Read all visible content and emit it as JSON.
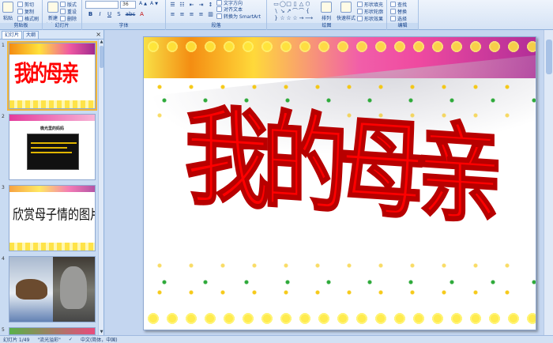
{
  "ribbon": {
    "clipboard": {
      "paste_label": "粘贴",
      "cut_label": "剪切",
      "copy_label": "复制",
      "format_painter_label": "格式刷",
      "group_label": "剪贴板"
    },
    "slides": {
      "new_slide_label": "新建\n幻灯片",
      "layout_label": "版式",
      "reset_label": "重设",
      "delete_label": "删除",
      "group_label": "幻灯片"
    },
    "font": {
      "font_name": "",
      "font_size": "36",
      "format_buttons": [
        "B",
        "I",
        "U",
        "S",
        "abc",
        "A"
      ],
      "group_label": "字体"
    },
    "paragraph": {
      "text_direction_label": "文字方向",
      "align_text_label": "对齐文本",
      "smartart_label": "转换为 SmartArt",
      "group_label": "段落"
    },
    "drawing": {
      "shapes": [
        "▭",
        "◯",
        "□",
        "▯",
        "△",
        "⬡",
        "\\",
        "↘",
        "↗",
        "⌒",
        "⌒",
        "{",
        "}",
        "☆",
        "☆",
        "☆",
        "→",
        "⟶"
      ],
      "arrange_label": "排列",
      "quick_styles_label": "快速样式",
      "fill_label": "形状填充",
      "outline_label": "形状轮廓",
      "effects_label": "形状效果",
      "group_label": "绘图"
    },
    "editing": {
      "find_label": "查找",
      "replace_label": "替换",
      "select_label": "选择",
      "group_label": "编辑"
    }
  },
  "panel": {
    "tabs": [
      "幻灯片",
      "大纲"
    ],
    "close_glyph": "×",
    "slides": [
      {
        "number": "1",
        "title": "我的母亲"
      },
      {
        "number": "2",
        "title": "微光里的妈妈"
      },
      {
        "number": "3",
        "title": "欣赏母子情的图片"
      },
      {
        "number": "4",
        "caption": ""
      },
      {
        "number": "5"
      }
    ]
  },
  "slide": {
    "title": "我的母亲"
  },
  "status": {
    "slide_counter": "幻灯片 1/49",
    "theme": "\"流光溢彩\"",
    "language": "中文(简体，中国)"
  }
}
